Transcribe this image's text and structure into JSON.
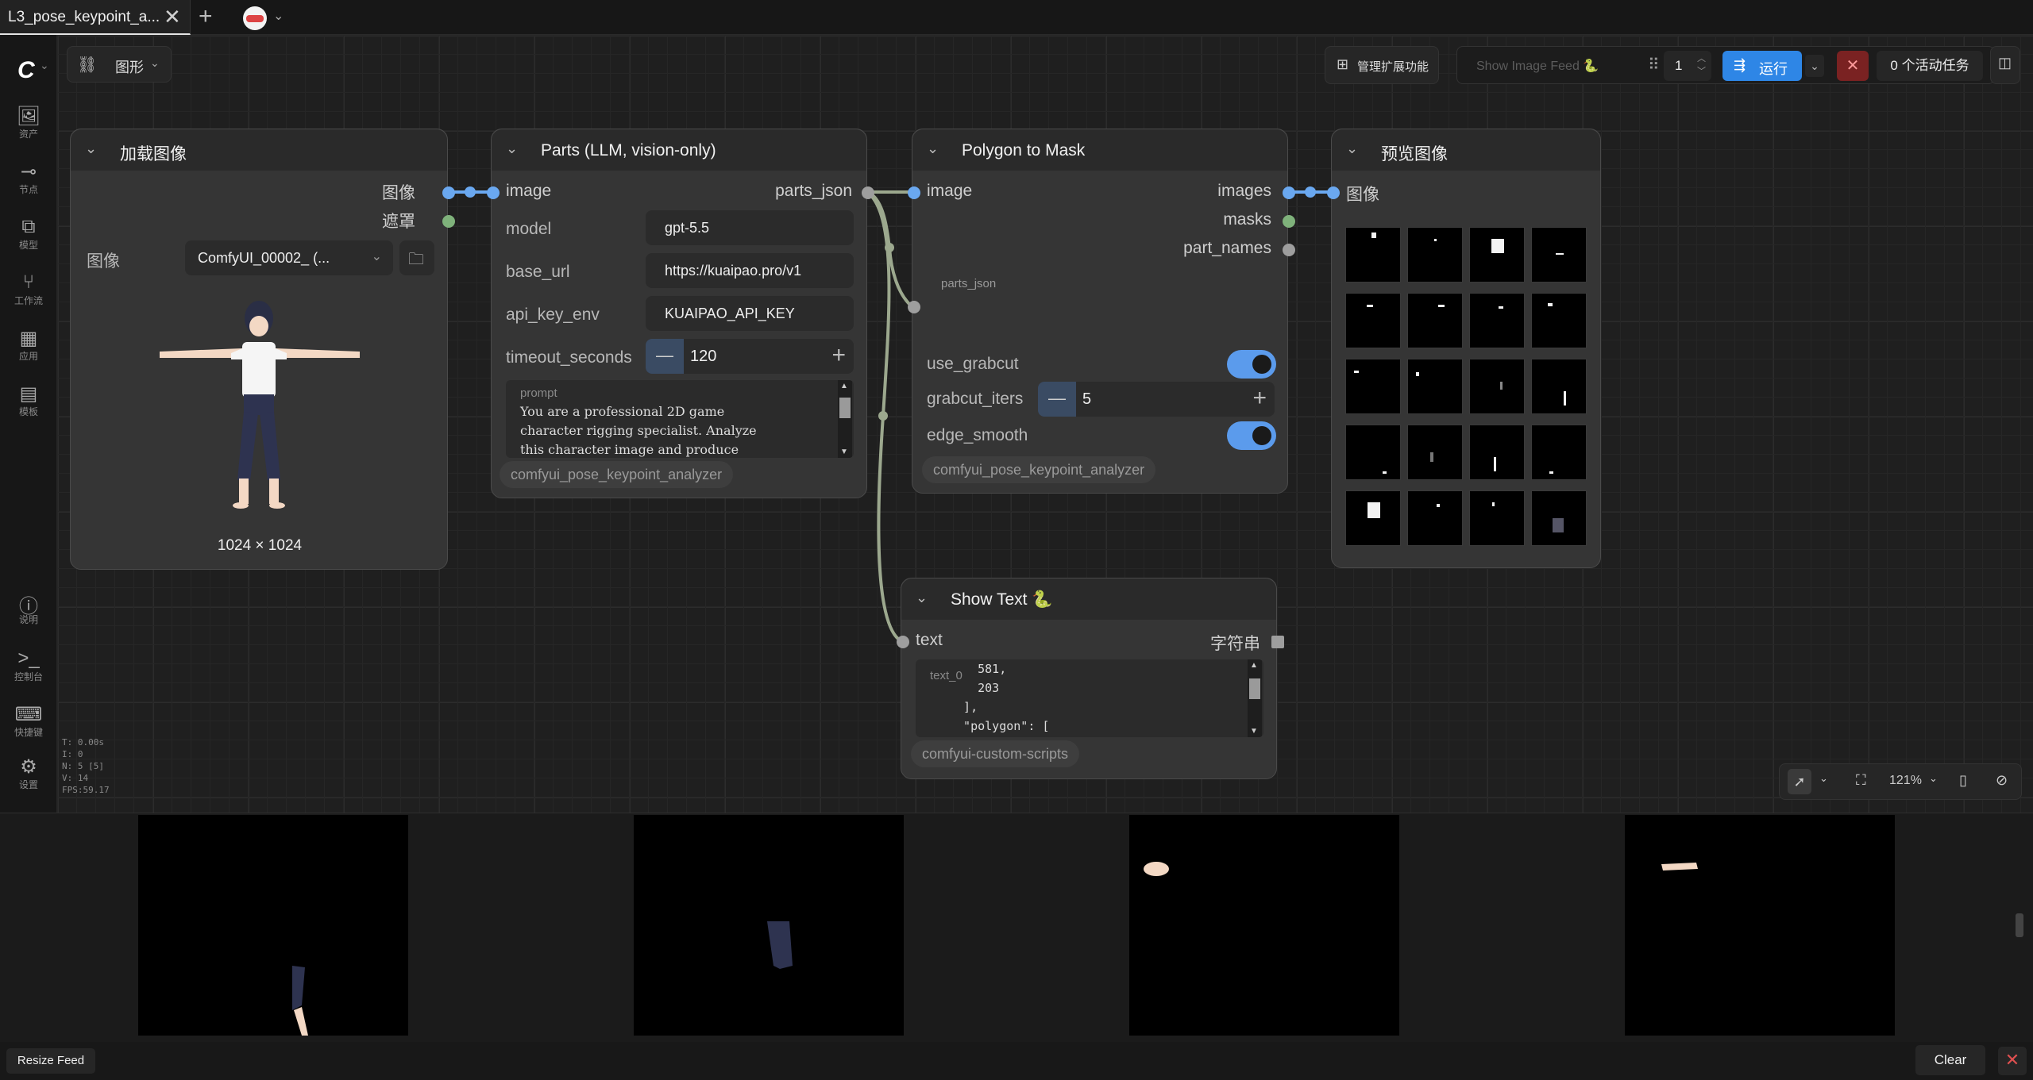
{
  "tab": {
    "title": "L3_pose_keypoint_a...",
    "close": "✕",
    "new_tab": "+"
  },
  "sidebar": {
    "items": [
      {
        "label": "资产",
        "icon": "image-icon"
      },
      {
        "label": "节点",
        "icon": "node-icon"
      },
      {
        "label": "模型",
        "icon": "model-icon"
      },
      {
        "label": "工作流",
        "icon": "workflow-icon"
      },
      {
        "label": "应用",
        "icon": "app-icon"
      },
      {
        "label": "模板",
        "icon": "template-icon"
      }
    ],
    "bottom_items": [
      {
        "label": "说明",
        "icon": "help-icon"
      },
      {
        "label": "控制台",
        "icon": "console-icon"
      },
      {
        "label": "快捷键",
        "icon": "keyboard-icon"
      },
      {
        "label": "设置",
        "icon": "settings-icon"
      }
    ]
  },
  "stats": {
    "t": "T: 0.00s",
    "i": "I: 0",
    "n": "N: 5 [5]",
    "v": "V: 14",
    "fps": "FPS:59.17"
  },
  "graph_menu": {
    "label": "图形"
  },
  "toolbar": {
    "manage_extensions": "管理扩展功能",
    "show_image_feed": "Show Image Feed 🐍",
    "queue_count": "1",
    "run": "运行",
    "active_jobs": "0 个活动任务"
  },
  "nodes": {
    "load_image": {
      "title": "加载图像",
      "out_image": "图像",
      "out_mask": "遮罩",
      "widget_label": "图像",
      "widget_value": "ComfyUI_00002_ (...",
      "dims": "1024 × 1024"
    },
    "parts_llm": {
      "title": "Parts (LLM, vision-only)",
      "in_image": "image",
      "out_parts_json": "parts_json",
      "model_label": "model",
      "model_value": "gpt-5.5",
      "base_url_label": "base_url",
      "base_url_value": "https://kuaipao.pro/v1",
      "api_key_env_label": "api_key_env",
      "api_key_env_value": "KUAIPAO_API_KEY",
      "timeout_label": "timeout_seconds",
      "timeout_value": "120",
      "prompt_label": "prompt",
      "prompt_text": "You are a professional 2D game\ncharacter rigging specialist. Analyze\nthis character image and produce",
      "badge": "comfyui_pose_keypoint_analyzer"
    },
    "polygon_mask": {
      "title": "Polygon to Mask",
      "in_image": "image",
      "in_parts_json": "parts_json",
      "out_images": "images",
      "out_masks": "masks",
      "out_part_names": "part_names",
      "use_grabcut_label": "use_grabcut",
      "grabcut_iters_label": "grabcut_iters",
      "grabcut_iters_value": "5",
      "edge_smooth_label": "edge_smooth",
      "use_grabcut": true,
      "edge_smooth": true,
      "badge": "comfyui_pose_keypoint_analyzer"
    },
    "preview_image": {
      "title": "预览图像",
      "in_image": "图像"
    },
    "show_text": {
      "title": "Show Text 🐍",
      "in_text": "text",
      "out_string": "字符串",
      "text_label": "text_0",
      "text_content": "    581,\n    203\n  ],\n  \"polygon\": [",
      "badge": "comfyui-custom-scripts"
    }
  },
  "canvas_controls": {
    "zoom": "121%"
  },
  "feed": {
    "resize": "Resize Feed",
    "clear": "Clear",
    "close": "✕"
  },
  "colors": {
    "accent": "#2e86e6",
    "link_image": "#6aa8f0",
    "link_mask": "#7fb27b",
    "link_string": "#9e9e9e",
    "stop": "#7a2222"
  }
}
